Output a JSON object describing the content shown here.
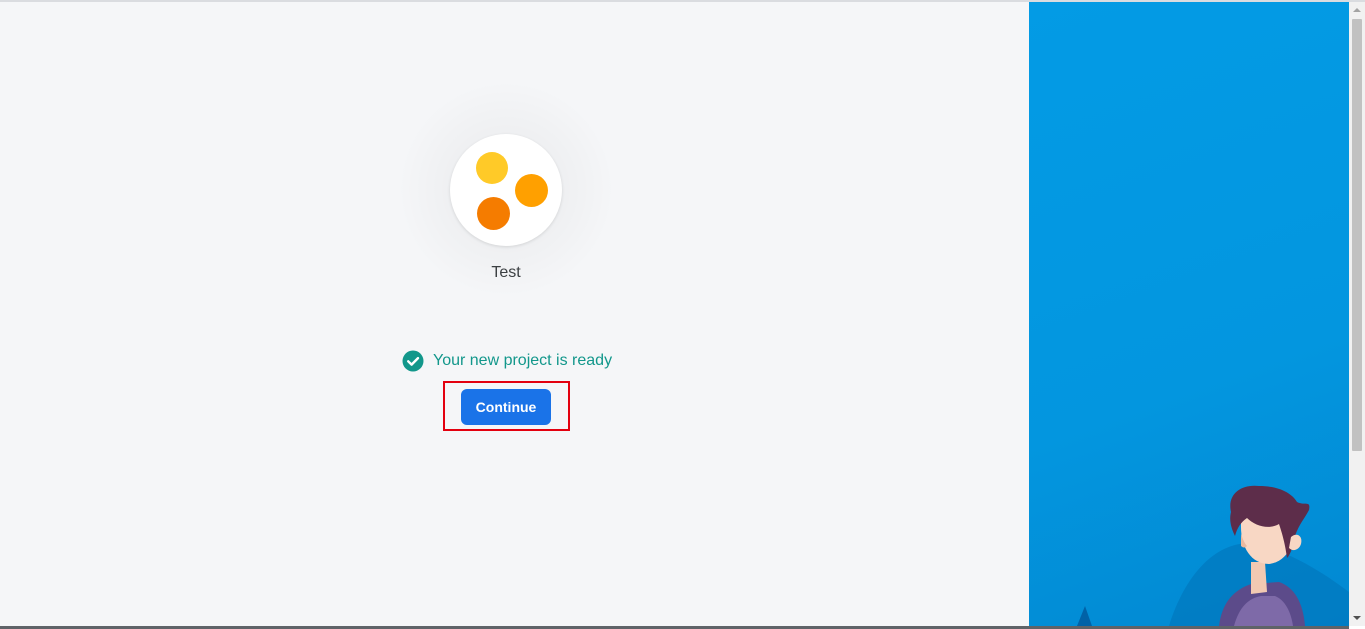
{
  "project": {
    "name": "Test",
    "logo_colors": [
      "#ffca28",
      "#ffa000",
      "#f57c00"
    ]
  },
  "status": {
    "message": "Your new project is ready",
    "icon": "check-circle-icon",
    "color": "#12978b"
  },
  "actions": {
    "continue_label": "Continue",
    "button_color": "#1a73e8",
    "highlight_color": "#e3000f"
  },
  "side_panel": {
    "background": "#039be5",
    "illustration": "person-illustration"
  },
  "scrollbar": {
    "up_icon": "scroll-up-arrow-icon",
    "down_icon": "scroll-down-arrow-icon"
  }
}
